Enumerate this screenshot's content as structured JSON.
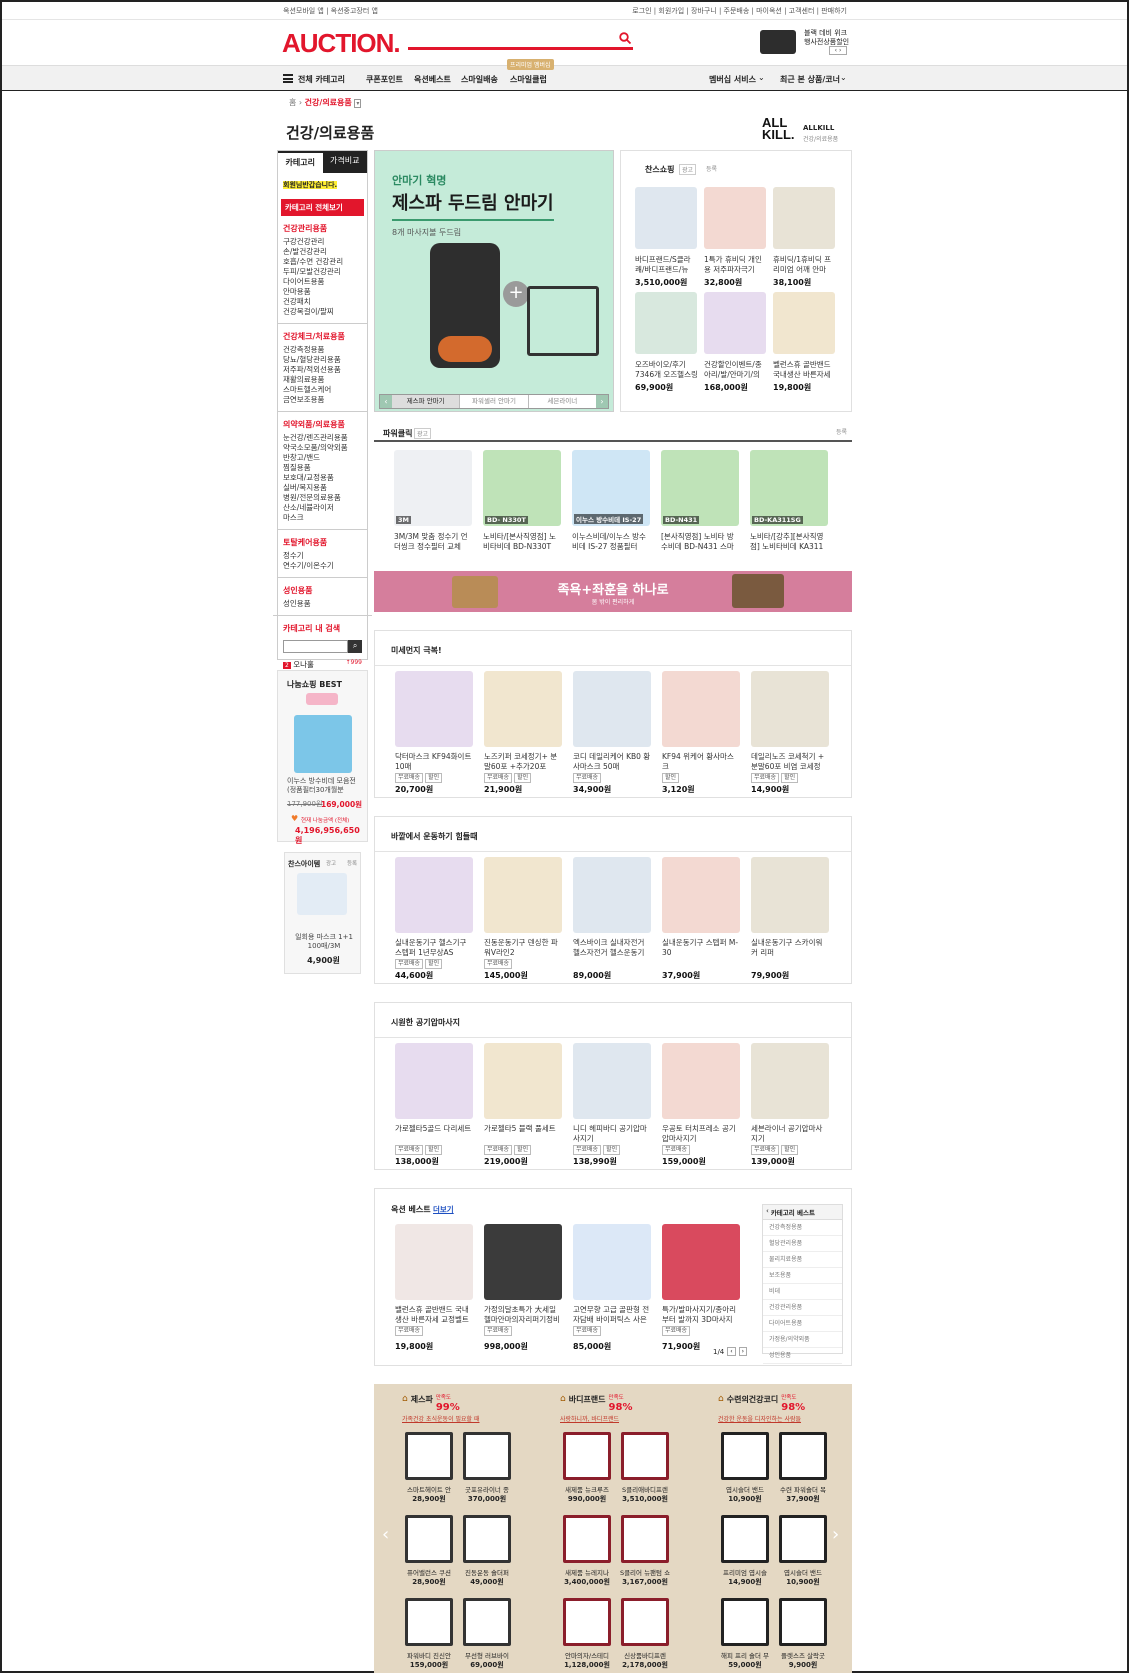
{
  "topbar": {
    "left": "옥션모바일 앱   |   옥션중고장터 앱",
    "right": "로그인  |  회원가입  |  장바구니  |  주문배송  |  마이옥션  |  고객센터  |  판매하기"
  },
  "logo": "AUCTION.",
  "promo": {
    "text1": "블랙 데비 위크",
    "text2": "행사전상품할인"
  },
  "nav": {
    "all_categories": "전체 카테고리",
    "items": [
      "쿠폰포인트",
      "옥션베스트",
      "스마일배송",
      "스마일클럽"
    ],
    "premium_badge": "프리미엄 멤버십",
    "membership": "멤버십 서비스",
    "recent": "최근 본 상품/코너"
  },
  "breadcrumb": {
    "home": "홈",
    "current": "건강/의료용품"
  },
  "page_title": "건강/의료용품",
  "allkill": {
    "logo": "ALL KILL.",
    "title": "ALLKILL",
    "sub": "건강/의료용품"
  },
  "sidebar": {
    "tab1": "카테고리",
    "tab2": "가격비교",
    "notice": "회원님반갑습니다.",
    "all_btn": "카테고리 전체보기",
    "groups": [
      {
        "head": "건강관리용품",
        "items": [
          "구강건강관리",
          "손/발건강관리",
          "호흡/수면 건강관리",
          "두피/모발건강관리",
          "다이어트용품",
          "안마용품",
          "건강패치",
          "건강목걸이/팔찌"
        ]
      },
      {
        "head": "건강체크/처료용품",
        "items": [
          "건강측정용품",
          "당뇨/혈당관리용품",
          "저주파/적외선용품",
          "재활의료용품",
          "스마트헬스케어",
          "금연보조용품"
        ]
      },
      {
        "head": "의약외품/의료용품",
        "items": [
          "눈건강/렌즈관리용품",
          "약국소모품/의약외품",
          "반창고/밴드",
          "찜질용품",
          "보호대/교정용품",
          "실버/복지용품",
          "병원/전문의료용품",
          "산소/네뷸라이저",
          "마스크"
        ]
      },
      {
        "head": "토탈케어용품",
        "items": [
          "정수기",
          "연수기/이온수기"
        ]
      },
      {
        "head": "성인용품",
        "items": [
          "성인용품"
        ]
      }
    ],
    "search_label": "카테고리 내 검색",
    "onnado": "오나홀",
    "count": "999"
  },
  "nanum": {
    "title": "나눔쇼핑 BEST",
    "product": "이누스 방수비데 모음전 (정품필터30개월분",
    "orig": "177,900원",
    "price": "169,000원",
    "total_label": "현재 나눔금액 (전체)",
    "total": "4,196,956,650원"
  },
  "chance_side": {
    "title": "찬스아이템",
    "ad": "광고",
    "reg": "등록",
    "product": "일회용 마스크 1+1 100매/3M",
    "price": "4,900원"
  },
  "hero": {
    "tag": "안마기 혁명",
    "title": "제스파 두드림 안마기",
    "sub": "8개 마사지볼 두드림",
    "tabs": [
      "제스파 안마기",
      "파워셀러 안마기",
      "세븐라이너"
    ]
  },
  "chance": {
    "title": "찬스쇼핑",
    "ad": "광고",
    "reg": "등록",
    "products": [
      {
        "name": "바디프랜드/S클라쾌/바디프랜드/뉴",
        "price": "3,510,000원"
      },
      {
        "name": "1특가 휴비딕 개인용 저주파자극기",
        "price": "32,800원"
      },
      {
        "name": "휴비딕/1휴비딕 프리미엄 어깨 안마",
        "price": "38,100원"
      },
      {
        "name": "오즈바이오/후기7346개 오즈헬스링",
        "price": "69,900원"
      },
      {
        "name": "건강할인이벤트/종아리/발/안마기/의",
        "price": "168,000원"
      },
      {
        "name": "벨런스휴 골반밴드 국내생산 바른자세",
        "price": "19,800원"
      }
    ]
  },
  "powerclick": {
    "title": "파워클릭",
    "ad": "광고",
    "reg": "등록",
    "products": [
      {
        "name": "3M/3M 맞춤 정수기 언더씽크 정수필터 교체",
        "img": "3M"
      },
      {
        "name": "노비타/[본사직영점] 노비타비데 BD-N330T",
        "img": "BD- N330T"
      },
      {
        "name": "이누스비데/이누스 방수비데 IS-27 정품필터",
        "img": "이누스 방수비데 IS-27"
      },
      {
        "name": "[본사직영점] 노비타 방수비데 BD-N431 스마트",
        "img": "BD-N431"
      },
      {
        "name": "노비타/[강추][본사직영점] 노비타비데 KA311",
        "img": "BD-KA311SG"
      }
    ]
  },
  "banner": {
    "title": "족욕+좌훈을 하나로",
    "sub": "몸 밖이 편리하게"
  },
  "sec1": {
    "title": "미세먼지 극복!",
    "products": [
      {
        "name": "닥터마스크 KF94화이트 10매",
        "badges": [
          "무료배송",
          "할인"
        ],
        "price": "20,700원"
      },
      {
        "name": "노즈키퍼 코세정기+ 분말60포 +추가20포",
        "badges": [
          "무료배송",
          "할인"
        ],
        "price": "21,900원"
      },
      {
        "name": "코디 데일리케어 KB0 황사마스크 50매",
        "badges": [
          "무료배송"
        ],
        "price": "34,900원"
      },
      {
        "name": "KF94 위케어 황사마스크",
        "badges": [
          "할인"
        ],
        "price": "3,120원"
      },
      {
        "name": "데일리노즈 코세척기 + 분말60포 비염 코세정",
        "badges": [
          "무료배송",
          "할인"
        ],
        "price": "14,900원"
      }
    ]
  },
  "sec2": {
    "title": "바깥에서 운동하기 힘들때",
    "products": [
      {
        "name": "실내운동기구 헬스기구 스텝퍼 1년무상AS",
        "badges": [
          "무료배송",
          "할인"
        ],
        "price": "44,600원"
      },
      {
        "name": "진동운동기구 덴싱한 파워V라인2",
        "badges": [
          "무료배송"
        ],
        "price": "145,000원"
      },
      {
        "name": "엑스바이크 실내자전거 헬스자전거 헬스운동기",
        "badges": [],
        "price": "89,000원"
      },
      {
        "name": "실내운동기구 스텝퍼 M-30",
        "badges": [],
        "price": "37,900원"
      },
      {
        "name": "실내운동기구 스카이워커 리퍼",
        "badges": [],
        "price": "79,900원"
      }
    ]
  },
  "sec3": {
    "title": "시원한 공기압마사지",
    "products": [
      {
        "name": "가로젤타5골드 다리세트",
        "badges": [
          "무료배송",
          "할인"
        ],
        "price": "138,000원"
      },
      {
        "name": "가로젤타5 블랙 풀세트",
        "badges": [
          "무료배송",
          "할인"
        ],
        "price": "219,000원"
      },
      {
        "name": "니디 헤피바디 공기압마사지기",
        "badges": [
          "무료배송",
          "할인"
        ],
        "price": "138,990원"
      },
      {
        "name": "우공토 터치프레소 공기압마사지기",
        "badges": [
          "무료배송"
        ],
        "price": "159,000원"
      },
      {
        "name": "세븐라이너 공기압마사지기",
        "badges": [
          "무료배송",
          "할인"
        ],
        "price": "139,000원"
      }
    ]
  },
  "best": {
    "title": "옥션 베스트",
    "more": "더보기",
    "products": [
      {
        "name": "밸런스휴 골반밴드 국내생산 바른자세 교정벨트",
        "badges": [
          "무료배송"
        ],
        "price": "19,800원"
      },
      {
        "name": "가정의달초특가 大세일 헬마안마의자리퍼기정비",
        "badges": [
          "무료배송"
        ],
        "price": "998,000원"
      },
      {
        "name": "고연무향 고급 골판형 전자담배 바이퍼틱스 사은",
        "badges": [
          "무료배송"
        ],
        "price": "85,000원"
      },
      {
        "name": "특가/발마사지기/종아리부터 발까지 3D마사지",
        "badges": [
          "무료배송"
        ],
        "price": "71,900원"
      }
    ],
    "pager": "1/4",
    "cat_title": "카테고리 베스트",
    "cats": [
      "건강측정용품",
      "혈당관리용품",
      "물리치료용품",
      "보조용품",
      "비데",
      "건강관리용품",
      "다이어트용품",
      "가정용/의약외품",
      "성인용품"
    ]
  },
  "bottom": {
    "cols": [
      {
        "name": "제스파",
        "label": "만족도",
        "rate": "99%",
        "link": "가족건강 초식운동이 필요할 때",
        "items": [
          {
            "name": "스마트헤이트 안",
            "price": "28,900원"
          },
          {
            "name": "굿포유라이너 종",
            "price": "370,000원"
          },
          {
            "name": "퓨어밸런스 쿠션",
            "price": "28,900원"
          },
          {
            "name": "진동운동 숄더퍼",
            "price": "49,000원"
          },
          {
            "name": "파워바디 진신안",
            "price": "159,000원"
          },
          {
            "name": "무선형 러브바이",
            "price": "69,000원"
          }
        ]
      },
      {
        "name": "바디프랜드",
        "label": "만족도",
        "rate": "98%",
        "link": "사랑하니까, 바디프랜드",
        "items": [
          {
            "name": "새제품 뉴크루즈",
            "price": "990,000원"
          },
          {
            "name": "S클리애바디프렌",
            "price": "3,510,000원"
          },
          {
            "name": "새제품 뉴레지나",
            "price": "3,400,000원"
          },
          {
            "name": "S클리어 뉴팬텀 쇼",
            "price": "3,167,000원"
          },
          {
            "name": "안마의자/스테디",
            "price": "1,128,000원"
          },
          {
            "name": "신상품바디프렌",
            "price": "2,178,000원"
          }
        ]
      },
      {
        "name": "수련의건강코디",
        "label": "만족도",
        "rate": "98%",
        "link": "건강한 운동을 디자인하는 사람들",
        "items": [
          {
            "name": "엽시슬더 밴드",
            "price": "10,900원"
          },
          {
            "name": "수련 파워숄더 목",
            "price": "37,900원"
          },
          {
            "name": "프리미엄 엽시슬",
            "price": "14,900원"
          },
          {
            "name": "엽시슬더 밴드",
            "price": "10,900원"
          },
          {
            "name": "해피 프리 숄더 무",
            "price": "59,000원"
          },
          {
            "name": "플렛스즈 살락굿",
            "price": "9,900원"
          }
        ]
      }
    ]
  }
}
